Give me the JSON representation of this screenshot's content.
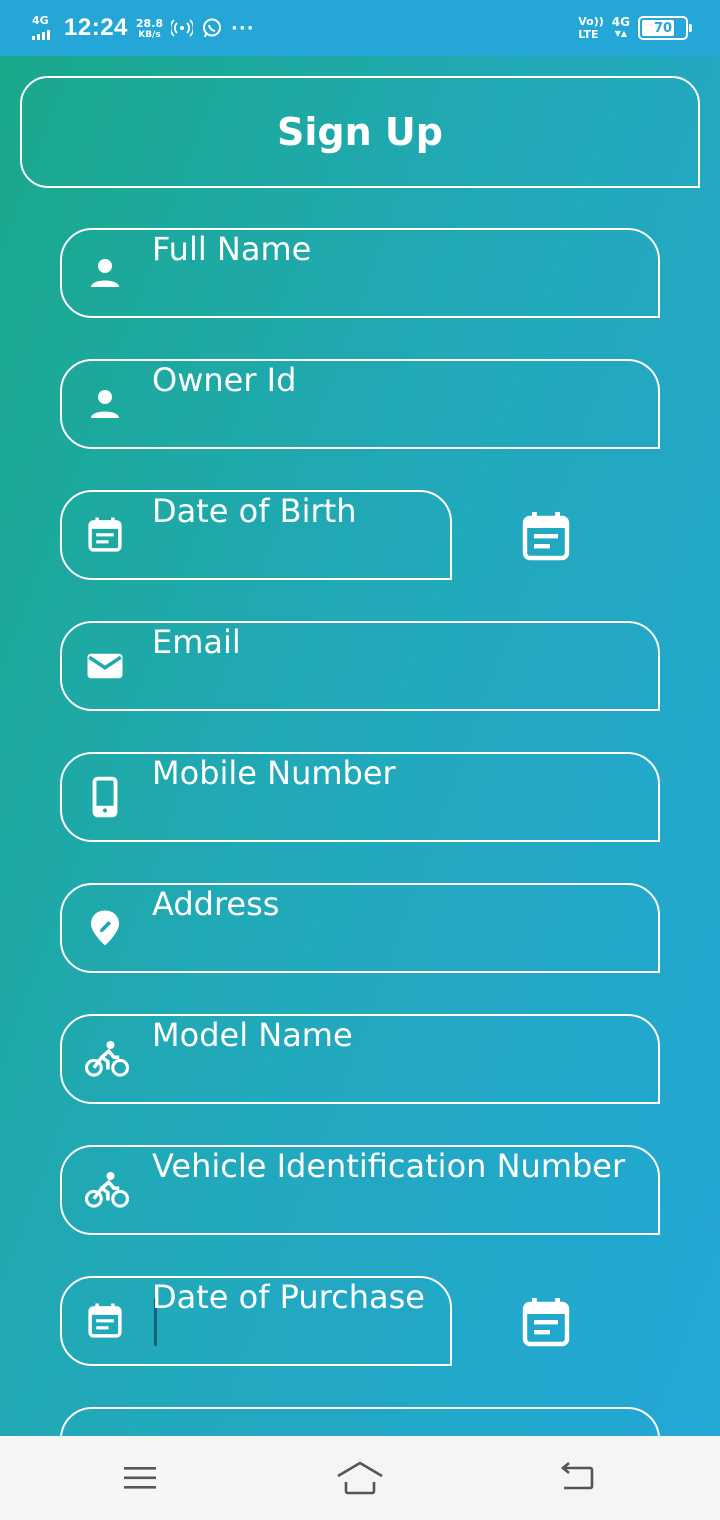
{
  "status_bar": {
    "network_label": "4G",
    "time": "12:24",
    "speed_value": "28.8",
    "speed_unit": "KB/s",
    "volte_top": "Vo))",
    "volte_bottom": "LTE",
    "network_type": "4G",
    "network_arrows": "▼▲",
    "battery_level": "70",
    "more_indicator": "···",
    "icons": [
      "signal-icon",
      "hotspot-icon",
      "whatsapp-icon",
      "battery-icon"
    ]
  },
  "header": {
    "title": "Sign Up"
  },
  "form": {
    "fields": [
      {
        "placeholder": "Full Name",
        "icon": "person-icon"
      },
      {
        "placeholder": "Owner Id",
        "icon": "person-icon"
      },
      {
        "placeholder": "Date of Birth",
        "icon": "calendar-icon"
      },
      {
        "placeholder": "Email",
        "icon": "email-icon"
      },
      {
        "placeholder": "Mobile Number",
        "icon": "phone-icon"
      },
      {
        "placeholder": "Address",
        "icon": "location-pin-icon"
      },
      {
        "placeholder": "Model Name",
        "icon": "bicycle-icon"
      },
      {
        "placeholder": "Vehicle Identification Number",
        "icon": "bicycle-icon"
      },
      {
        "placeholder": "Date of Purchase",
        "icon": "calendar-icon"
      }
    ]
  },
  "nav_bar": {
    "icons": [
      "menu-icon",
      "home-icon",
      "back-icon"
    ]
  },
  "colors": {
    "status_bar": "#24a6d6",
    "gradient_start": "#19a98a",
    "gradient_end": "#23a7d6",
    "text": "#ffffff",
    "nav_bar": "#f5f5f5",
    "nav_icon": "#555555"
  }
}
